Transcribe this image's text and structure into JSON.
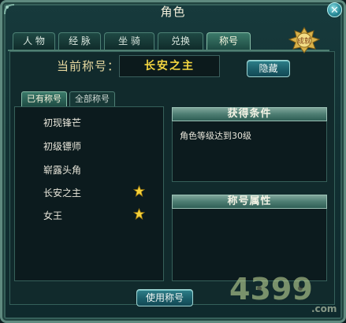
{
  "window": {
    "title": "角色",
    "close_label": "✕"
  },
  "tabs": [
    {
      "label": "人 物",
      "active": false
    },
    {
      "label": "经 脉",
      "active": false
    },
    {
      "label": "坐 骑",
      "active": false
    },
    {
      "label": "兑换",
      "active": false
    },
    {
      "label": "称号",
      "active": true
    }
  ],
  "badge": {
    "text": "成就"
  },
  "current_title": {
    "label": "当前称号：",
    "value": "长安之主"
  },
  "buttons": {
    "hide": "隐藏",
    "use": "使用称号"
  },
  "subtabs": [
    {
      "label": "已有称号",
      "active": true
    },
    {
      "label": "全部称号",
      "active": false
    }
  ],
  "titles_list": [
    {
      "name": "初现锋芒",
      "starred": false
    },
    {
      "name": "初级镖师",
      "starred": false
    },
    {
      "name": "崭露头角",
      "starred": false
    },
    {
      "name": "长安之主",
      "starred": true
    },
    {
      "name": "女王",
      "starred": true
    }
  ],
  "conditions": {
    "header": "获得条件",
    "text": "角色等级达到30级"
  },
  "attributes": {
    "header": "称号属性"
  },
  "watermark": {
    "text": "4399",
    "suffix": ".com"
  },
  "colors": {
    "gold": "#f4d641",
    "panel_bg": "#0c1b1e",
    "accent": "#2f7f8a"
  }
}
